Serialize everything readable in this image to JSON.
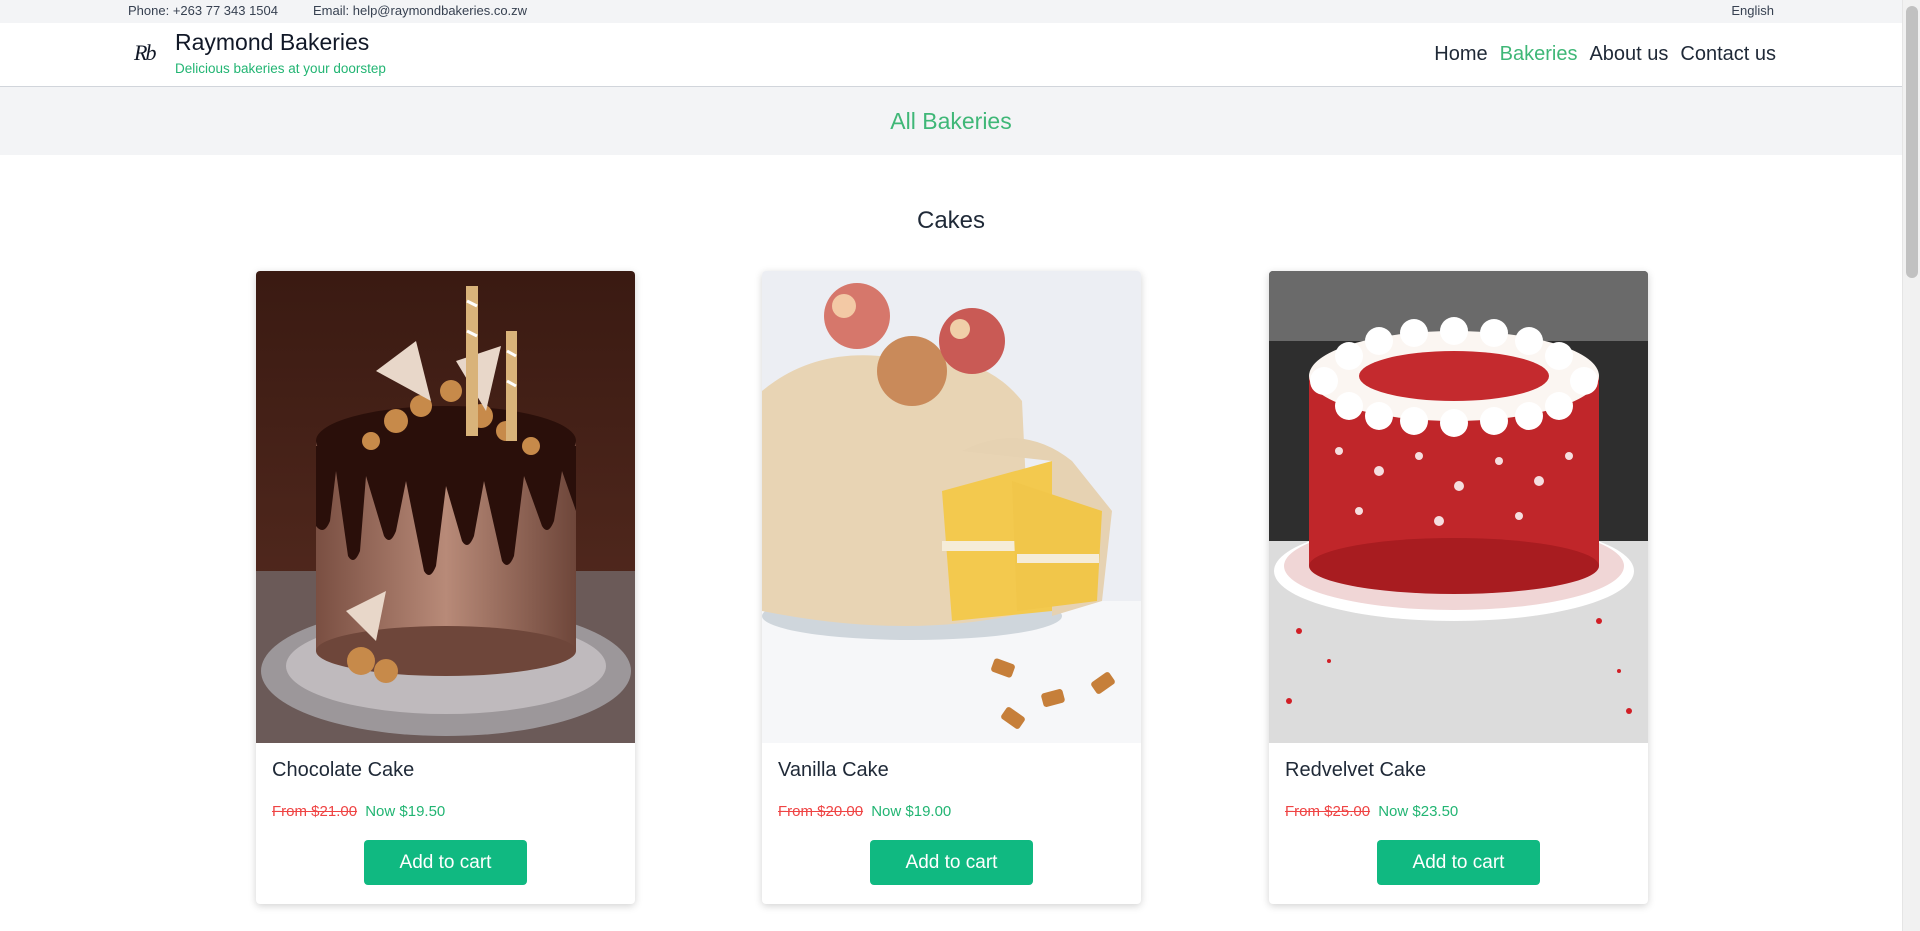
{
  "topbar": {
    "phone": "Phone: +263 77 343 1504",
    "email": "Email: help@raymondbakeries.co.zw",
    "language": "English"
  },
  "header": {
    "logo_text": "Rb",
    "brand_name": "Raymond Bakeries",
    "tagline": "Delicious bakeries at your doorstep",
    "nav": [
      {
        "label": "Home",
        "active": false
      },
      {
        "label": "Bakeries",
        "active": true
      },
      {
        "label": "About us",
        "active": false
      },
      {
        "label": "Contact us",
        "active": false
      }
    ]
  },
  "page_title": "All Bakeries",
  "section": {
    "heading": "Cakes",
    "products": [
      {
        "name": "Chocolate Cake",
        "old_price": "From $21.00",
        "new_price": "Now $19.50",
        "button": "Add to cart"
      },
      {
        "name": "Vanilla Cake",
        "old_price": "From $20.00",
        "new_price": "Now $19.00",
        "button": "Add to cart"
      },
      {
        "name": "Redvelvet Cake",
        "old_price": "From $25.00",
        "new_price": "Now $23.50",
        "button": "Add to cart"
      }
    ]
  },
  "colors": {
    "accent_green": "#3fb777",
    "button_green": "#10b981",
    "strike_red": "#ef4444",
    "band_gray": "#f3f4f6"
  }
}
